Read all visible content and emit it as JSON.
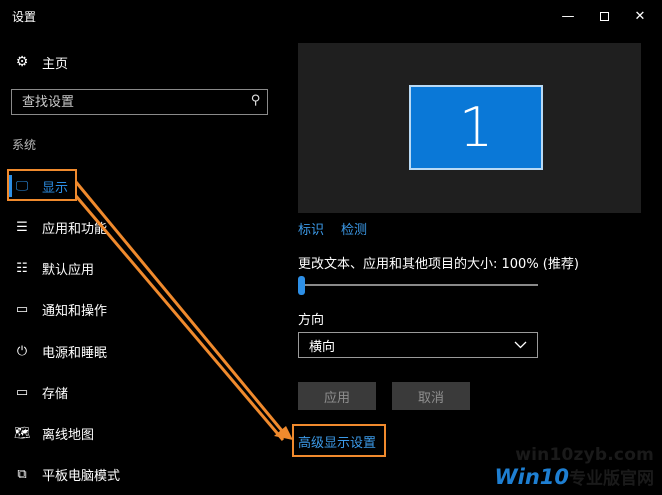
{
  "window": {
    "title": "设置",
    "controls": {
      "minimize": "—",
      "maximize": "",
      "close": "✕"
    }
  },
  "sidebar": {
    "home": {
      "icon": "gear-icon",
      "label": "主页"
    },
    "search": {
      "placeholder": "查找设置",
      "icon": "search-icon"
    },
    "section_label": "系统",
    "items": [
      {
        "icon": "monitor-icon",
        "label": "显示",
        "active": true
      },
      {
        "icon": "apps-list-icon",
        "label": "应用和功能"
      },
      {
        "icon": "default-apps-icon",
        "label": "默认应用"
      },
      {
        "icon": "message-icon",
        "label": "通知和操作"
      },
      {
        "icon": "power-icon",
        "label": "电源和睡眠"
      },
      {
        "icon": "storage-icon",
        "label": "存储"
      },
      {
        "icon": "map-icon",
        "label": "离线地图"
      },
      {
        "icon": "tablet-icon",
        "label": "平板电脑模式"
      }
    ]
  },
  "main": {
    "monitor_number": "1",
    "identify_link": "标识",
    "detect_link": "检测",
    "scale_label": "更改文本、应用和其他项目的大小: 100% (推荐)",
    "scale_value_fraction": 0,
    "orientation": {
      "label": "方向",
      "value": "横向"
    },
    "apply_button": "应用",
    "cancel_button": "取消",
    "advanced_link": "高级显示设置"
  },
  "watermark": {
    "line1": "win10zyb.com",
    "line2_brand": "Win10",
    "line2_text": "专业版官网"
  },
  "colors": {
    "accent": "#2d8fe6",
    "highlight": "#f08a2d",
    "monitor": "#0a78d7",
    "link": "#3c9ae8"
  }
}
